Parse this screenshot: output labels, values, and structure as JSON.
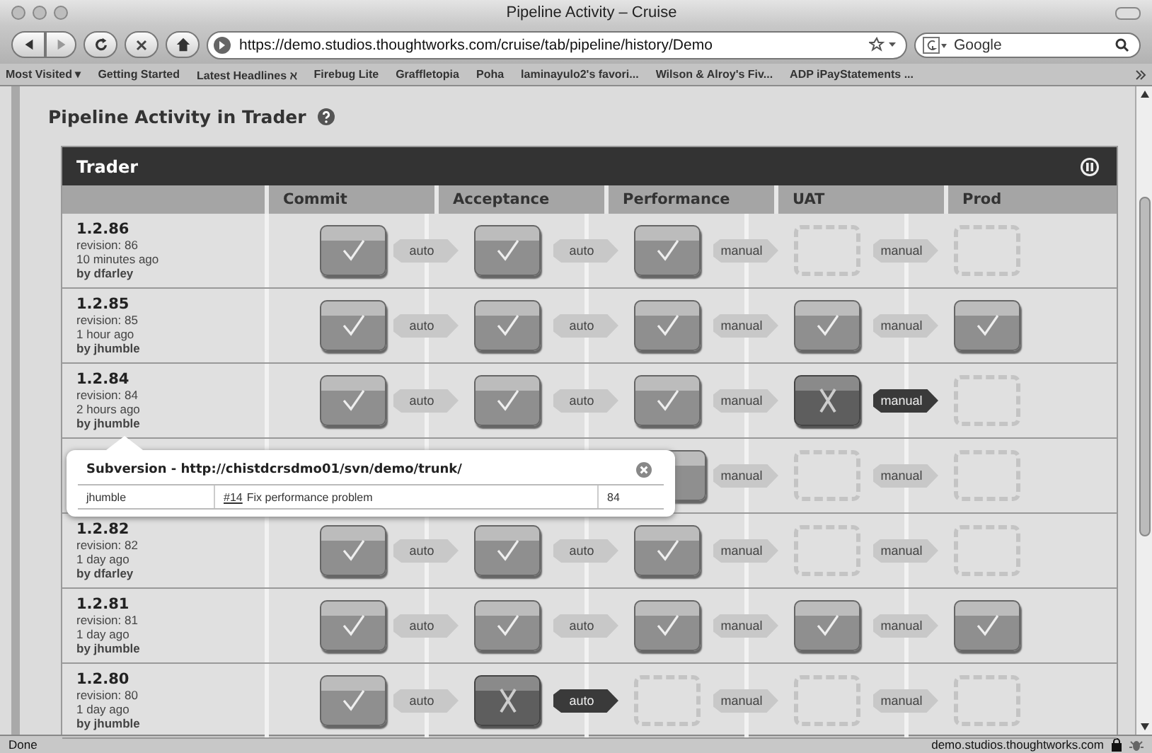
{
  "window": {
    "title": "Pipeline Activity – Cruise"
  },
  "toolbar": {
    "url": "https://demo.studios.thoughtworks.com/cruise/tab/pipeline/history/Demo",
    "search_placeholder": "Google"
  },
  "bookmarks": [
    "Most Visited ▾",
    "Getting Started",
    "Latest Headlines ℵ",
    "Firebug Lite",
    "Graffletopia",
    "Poha",
    "laminayulo2's favori...",
    "Wilson & Alroy's Fiv...",
    "ADP iPayStatements ..."
  ],
  "page": {
    "heading": "Pipeline Activity in Trader",
    "pipeline": {
      "name": "Trader",
      "columns": [
        "Commit",
        "Acceptance",
        "Performance",
        "UAT",
        "Prod"
      ],
      "rows": [
        {
          "label": "1.2.86",
          "revision": "revision: 86",
          "time": "10 minutes ago",
          "author": "by dfarley",
          "stages": [
            {
              "kind": "passed"
            },
            {
              "kind": "passed",
              "trigger": {
                "text": "auto",
                "active": false
              }
            },
            {
              "kind": "passed",
              "trigger": {
                "text": "auto",
                "active": false
              }
            },
            {
              "kind": "pending",
              "trigger": {
                "text": "manual",
                "active": false
              }
            },
            {
              "kind": "pending",
              "trigger": {
                "text": "manual",
                "active": false
              }
            }
          ]
        },
        {
          "label": "1.2.85",
          "revision": "revision: 85",
          "time": "1 hour ago",
          "author": "by jhumble",
          "stages": [
            {
              "kind": "passed"
            },
            {
              "kind": "passed",
              "trigger": {
                "text": "auto",
                "active": false
              }
            },
            {
              "kind": "passed",
              "trigger": {
                "text": "auto",
                "active": false
              }
            },
            {
              "kind": "passed",
              "trigger": {
                "text": "manual",
                "active": false
              }
            },
            {
              "kind": "passed",
              "trigger": {
                "text": "manual",
                "active": false
              }
            }
          ]
        },
        {
          "label": "1.2.84",
          "revision": "revision: 84",
          "time": "2 hours ago",
          "author": "by jhumble",
          "stages": [
            {
              "kind": "passed"
            },
            {
              "kind": "passed",
              "trigger": {
                "text": "auto",
                "active": false
              }
            },
            {
              "kind": "passed",
              "trigger": {
                "text": "auto",
                "active": false
              }
            },
            {
              "kind": "failed",
              "trigger": {
                "text": "manual",
                "active": false
              }
            },
            {
              "kind": "pending",
              "trigger": {
                "text": "manual",
                "active": true
              }
            }
          ]
        },
        {
          "stages": [
            {
              "kind": "covered"
            },
            {
              "kind": "covered"
            },
            {
              "kind": "obscured"
            },
            {
              "kind": "pending",
              "trigger": {
                "text": "manual",
                "active": false
              }
            },
            {
              "kind": "pending",
              "trigger": {
                "text": "manual",
                "active": false
              }
            }
          ]
        },
        {
          "label": "1.2.82",
          "revision": "revision: 82",
          "time": "1 day ago",
          "author": "by dfarley",
          "stages": [
            {
              "kind": "passed"
            },
            {
              "kind": "passed",
              "trigger": {
                "text": "auto",
                "active": false
              }
            },
            {
              "kind": "passed",
              "trigger": {
                "text": "auto",
                "active": false
              }
            },
            {
              "kind": "pending",
              "trigger": {
                "text": "manual",
                "active": false
              }
            },
            {
              "kind": "pending",
              "trigger": {
                "text": "manual",
                "active": false
              }
            }
          ]
        },
        {
          "label": "1.2.81",
          "revision": "revision: 81",
          "time": "1 day ago",
          "author": "by jhumble",
          "stages": [
            {
              "kind": "passed"
            },
            {
              "kind": "passed",
              "trigger": {
                "text": "auto",
                "active": false
              }
            },
            {
              "kind": "passed",
              "trigger": {
                "text": "auto",
                "active": false
              }
            },
            {
              "kind": "passed",
              "trigger": {
                "text": "manual",
                "active": false
              }
            },
            {
              "kind": "passed",
              "trigger": {
                "text": "manual",
                "active": false
              }
            }
          ]
        },
        {
          "label": "1.2.80",
          "revision": "revision: 80",
          "time": "1 day ago",
          "author": "by jhumble",
          "stages": [
            {
              "kind": "passed"
            },
            {
              "kind": "failed",
              "trigger": {
                "text": "auto",
                "active": false
              }
            },
            {
              "kind": "pending",
              "trigger": {
                "text": "auto",
                "active": true
              }
            },
            {
              "kind": "pending",
              "trigger": {
                "text": "manual",
                "active": false
              }
            },
            {
              "kind": "pending",
              "trigger": {
                "text": "manual",
                "active": false
              }
            }
          ]
        }
      ]
    },
    "popup": {
      "title": "Subversion - http://chistdcrsdmo01/svn/demo/trunk/",
      "user": "jhumble",
      "link": "#14",
      "message": "Fix performance problem",
      "revision": "84"
    }
  },
  "status_bar": {
    "text": "Done",
    "host": "demo.studios.thoughtworks.com"
  }
}
